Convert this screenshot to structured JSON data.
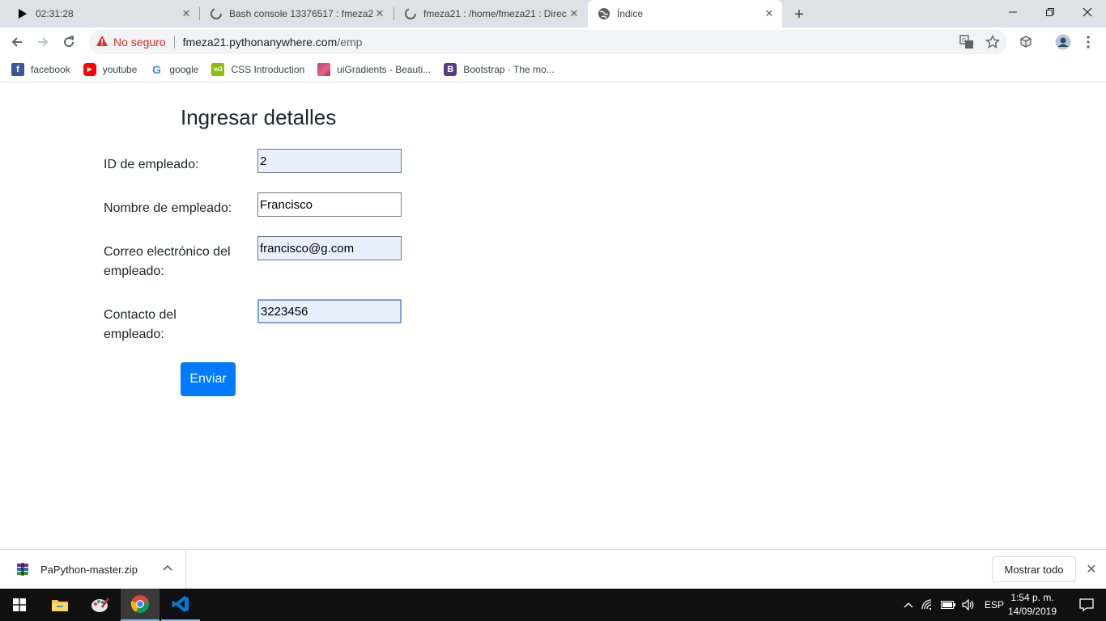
{
  "tabs": [
    {
      "title": "02:31:28",
      "icon": "play-cursor-icon"
    },
    {
      "title": "Bash console 13376517 : fmeza2",
      "icon": "loading-icon"
    },
    {
      "title": "fmeza21 : /home/fmeza21 : Direc",
      "icon": "loading-icon"
    },
    {
      "title": "Índice",
      "icon": "globe-icon",
      "active": true
    }
  ],
  "omnibox": {
    "security_label": "No seguro",
    "url_host": "fmeza21.pythonanywhere.com",
    "url_path": "/emp"
  },
  "bookmarks": [
    {
      "label": "facebook",
      "icon": "facebook-icon",
      "color": "#3b5998",
      "glyph": "f"
    },
    {
      "label": "youtube",
      "icon": "youtube-icon",
      "color": "#ff0000",
      "glyph": "▶"
    },
    {
      "label": "google",
      "icon": "google-icon",
      "color": "#ffffff",
      "glyph": "G"
    },
    {
      "label": "CSS Introduction",
      "icon": "w3schools-icon",
      "color": "#8ac007",
      "glyph": "w3"
    },
    {
      "label": "uiGradients - Beauti...",
      "icon": "uigradients-icon",
      "color": "#b24592",
      "glyph": ""
    },
    {
      "label": "Bootstrap · The mo...",
      "icon": "bootstrap-icon",
      "color": "#563d7c",
      "glyph": "B"
    }
  ],
  "form": {
    "title": "Ingresar detalles",
    "fields": [
      {
        "label": "ID de empleado:",
        "value": "2"
      },
      {
        "label": "Nombre de empleado:",
        "value": "Francisco"
      },
      {
        "label": "Correo electrónico del empleado:",
        "value": "francisco@g.com"
      },
      {
        "label": "Contacto del empleado:",
        "value": "3223456"
      }
    ],
    "submit_label": "Enviar",
    "button_color": "#007bff"
  },
  "downloads": {
    "file_name": "PaPython-master.zip",
    "show_all_label": "Mostrar todo"
  },
  "taskbar": {
    "language": "ESP",
    "time": "1:54 p. m.",
    "date": "14/09/2019"
  }
}
